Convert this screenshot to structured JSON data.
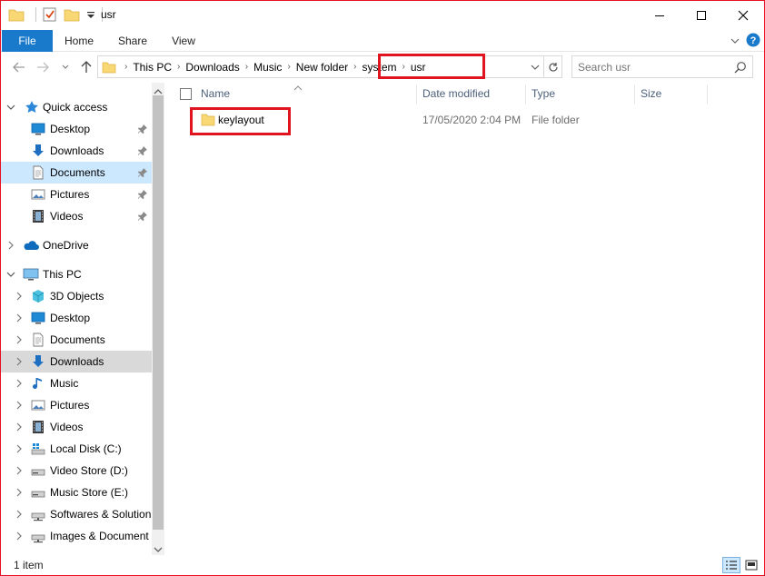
{
  "window": {
    "title": "usr",
    "controls": [
      "minimize",
      "maximize",
      "close"
    ]
  },
  "ribbon": {
    "tabs": [
      "File",
      "Home",
      "Share",
      "View"
    ]
  },
  "address": {
    "crumbs": [
      "This PC",
      "Downloads",
      "Music",
      "New folder",
      "system",
      "usr"
    ]
  },
  "search": {
    "placeholder": "Search usr"
  },
  "sidebar": {
    "quick_access": {
      "label": "Quick access",
      "items": [
        "Desktop",
        "Downloads",
        "Documents",
        "Pictures",
        "Videos"
      ]
    },
    "onedrive": "OneDrive",
    "this_pc": {
      "label": "This PC",
      "items": [
        "3D Objects",
        "Desktop",
        "Documents",
        "Downloads",
        "Music",
        "Pictures",
        "Videos",
        "Local Disk (C:)",
        "Video Store (D:)",
        "Music Store (E:)",
        "Softwares & Solution",
        "Images & Document"
      ]
    }
  },
  "columns": {
    "name": "Name",
    "date": "Date modified",
    "type": "Type",
    "size": "Size"
  },
  "files": [
    {
      "name": "keylayout",
      "date": "17/05/2020 2:04 PM",
      "type": "File folder",
      "size": ""
    }
  ],
  "status": {
    "count": "1 item"
  },
  "colors": {
    "accent": "#1979ca",
    "highlight": "#e0141e",
    "folder": "#f8d775"
  }
}
